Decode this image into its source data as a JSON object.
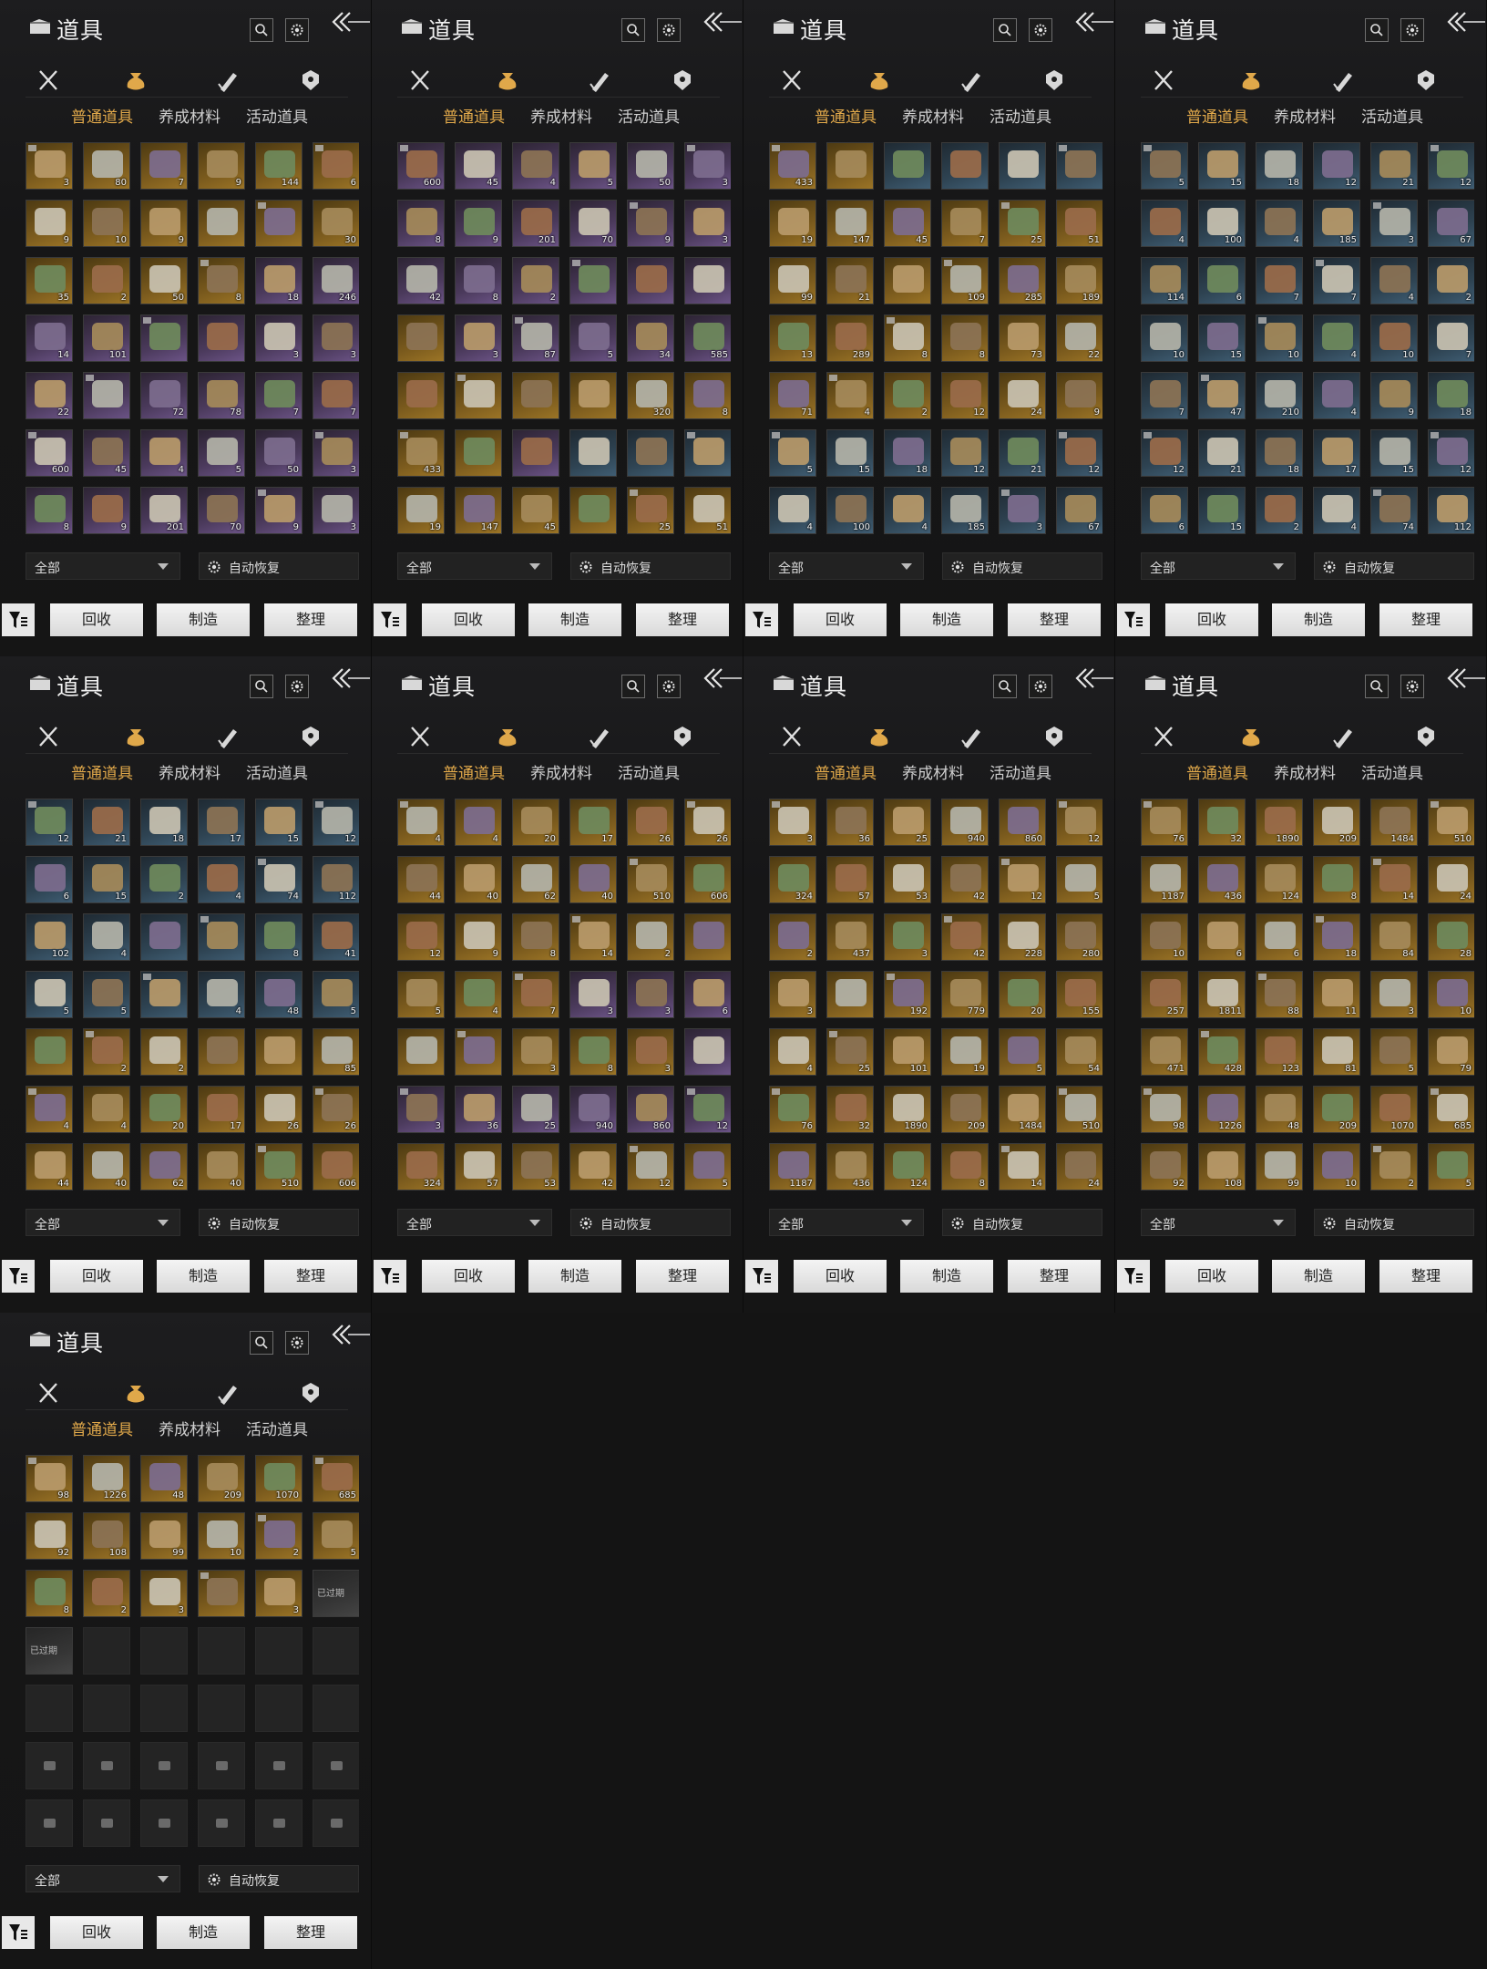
{
  "screen": {
    "title": "道具",
    "subtabs": [
      "普通道具",
      "养成材料",
      "活动道具"
    ],
    "active_subtab": 0,
    "filter": {
      "selected": "全部"
    },
    "auto_restore_label": "自动恢复",
    "buttons": {
      "recycle": "回收",
      "craft": "制造",
      "sort": "整理"
    },
    "category_icons": [
      "crossed-swords-icon",
      "pouch-icon",
      "scroll-brush-icon",
      "badge-icon"
    ],
    "colors": {
      "accent": "#e0a84a",
      "background": "#141414"
    }
  },
  "panels": [
    {
      "items": [
        [
          "3",
          "g"
        ],
        [
          "80",
          "g"
        ],
        [
          "7",
          "g"
        ],
        [
          "9",
          "g"
        ],
        [
          "144",
          "g"
        ],
        [
          "6",
          "g"
        ],
        [
          "9",
          "g"
        ],
        [
          "10",
          "g"
        ],
        [
          "9",
          "g"
        ],
        [
          "",
          "g"
        ],
        [
          "",
          "g"
        ],
        [
          "30",
          "g"
        ],
        [
          "35",
          "g"
        ],
        [
          "2",
          "g"
        ],
        [
          "50",
          "g"
        ],
        [
          "8",
          "g"
        ],
        [
          "18",
          "p"
        ],
        [
          "246",
          "p"
        ],
        [
          "14",
          "p"
        ],
        [
          "101",
          "p"
        ],
        [
          "",
          "p"
        ],
        [
          "",
          "p"
        ],
        [
          "3",
          "p"
        ],
        [
          "3",
          "p"
        ],
        [
          "22",
          "p"
        ],
        [
          "",
          "p"
        ],
        [
          "72",
          "p"
        ],
        [
          "78",
          "p"
        ],
        [
          "7",
          "p"
        ],
        [
          "7",
          "p"
        ],
        [
          "600",
          "p"
        ],
        [
          "45",
          "p"
        ],
        [
          "4",
          "p"
        ],
        [
          "5",
          "p"
        ],
        [
          "50",
          "p"
        ],
        [
          "3",
          "p"
        ],
        [
          "8",
          "p"
        ],
        [
          "9",
          "p"
        ],
        [
          "201",
          "p"
        ],
        [
          "70",
          "p"
        ],
        [
          "9",
          "p"
        ],
        [
          "3",
          "p"
        ]
      ]
    },
    {
      "items": [
        [
          "600",
          "p"
        ],
        [
          "45",
          "p"
        ],
        [
          "4",
          "p"
        ],
        [
          "5",
          "p"
        ],
        [
          "50",
          "p"
        ],
        [
          "3",
          "p"
        ],
        [
          "8",
          "p"
        ],
        [
          "9",
          "p"
        ],
        [
          "201",
          "p"
        ],
        [
          "70",
          "p"
        ],
        [
          "9",
          "p"
        ],
        [
          "3",
          "p"
        ],
        [
          "42",
          "p"
        ],
        [
          "8",
          "p"
        ],
        [
          "2",
          "p"
        ],
        [
          "",
          "p"
        ],
        [
          "",
          "p"
        ],
        [
          "",
          "p"
        ],
        [
          "",
          "g"
        ],
        [
          "3",
          "p"
        ],
        [
          "87",
          "p"
        ],
        [
          "5",
          "p"
        ],
        [
          "34",
          "p"
        ],
        [
          "585",
          "p"
        ],
        [
          "",
          "g"
        ],
        [
          "",
          "g"
        ],
        [
          "",
          "g"
        ],
        [
          "",
          "g"
        ],
        [
          "320",
          "g"
        ],
        [
          "8",
          "g"
        ],
        [
          "433",
          "g"
        ],
        [
          "",
          "g"
        ],
        [
          "",
          "p"
        ],
        [
          "",
          "b"
        ],
        [
          "",
          "b"
        ],
        [
          "",
          "b"
        ],
        [
          "19",
          "g"
        ],
        [
          "147",
          "g"
        ],
        [
          "45",
          "g"
        ],
        [
          "",
          "g"
        ],
        [
          "25",
          "g"
        ],
        [
          "51",
          "g"
        ]
      ]
    },
    {
      "items": [
        [
          "433",
          "g"
        ],
        [
          "",
          "g"
        ],
        [
          "",
          "b"
        ],
        [
          "",
          "b"
        ],
        [
          "",
          "b"
        ],
        [
          "",
          "b"
        ],
        [
          "19",
          "g"
        ],
        [
          "147",
          "g"
        ],
        [
          "45",
          "g"
        ],
        [
          "7",
          "g"
        ],
        [
          "25",
          "g"
        ],
        [
          "51",
          "g"
        ],
        [
          "99",
          "g"
        ],
        [
          "21",
          "g"
        ],
        [
          "",
          "g"
        ],
        [
          "109",
          "g"
        ],
        [
          "285",
          "g"
        ],
        [
          "189",
          "g"
        ],
        [
          "13",
          "g"
        ],
        [
          "289",
          "g"
        ],
        [
          "8",
          "g"
        ],
        [
          "8",
          "g"
        ],
        [
          "73",
          "g"
        ],
        [
          "22",
          "g"
        ],
        [
          "71",
          "g"
        ],
        [
          "4",
          "g"
        ],
        [
          "2",
          "g"
        ],
        [
          "12",
          "g"
        ],
        [
          "24",
          "g"
        ],
        [
          "9",
          "g"
        ],
        [
          "5",
          "b"
        ],
        [
          "15",
          "b"
        ],
        [
          "18",
          "b"
        ],
        [
          "12",
          "b"
        ],
        [
          "21",
          "b"
        ],
        [
          "12",
          "b"
        ],
        [
          "4",
          "b"
        ],
        [
          "100",
          "b"
        ],
        [
          "4",
          "b"
        ],
        [
          "185",
          "b"
        ],
        [
          "3",
          "b"
        ],
        [
          "67",
          "b"
        ]
      ]
    },
    {
      "items": [
        [
          "5",
          "b"
        ],
        [
          "15",
          "b"
        ],
        [
          "18",
          "b"
        ],
        [
          "12",
          "b"
        ],
        [
          "21",
          "b"
        ],
        [
          "12",
          "b"
        ],
        [
          "4",
          "b"
        ],
        [
          "100",
          "b"
        ],
        [
          "4",
          "b"
        ],
        [
          "185",
          "b"
        ],
        [
          "3",
          "b"
        ],
        [
          "67",
          "b"
        ],
        [
          "114",
          "b"
        ],
        [
          "6",
          "b"
        ],
        [
          "7",
          "b"
        ],
        [
          "7",
          "b"
        ],
        [
          "4",
          "b"
        ],
        [
          "2",
          "b"
        ],
        [
          "10",
          "b"
        ],
        [
          "15",
          "b"
        ],
        [
          "10",
          "b"
        ],
        [
          "4",
          "b"
        ],
        [
          "10",
          "b"
        ],
        [
          "7",
          "b"
        ],
        [
          "7",
          "b"
        ],
        [
          "47",
          "b"
        ],
        [
          "210",
          "b"
        ],
        [
          "4",
          "b"
        ],
        [
          "9",
          "b"
        ],
        [
          "18",
          "b"
        ],
        [
          "12",
          "b"
        ],
        [
          "21",
          "b"
        ],
        [
          "18",
          "b"
        ],
        [
          "17",
          "b"
        ],
        [
          "15",
          "b"
        ],
        [
          "12",
          "b"
        ],
        [
          "6",
          "b"
        ],
        [
          "15",
          "b"
        ],
        [
          "2",
          "b"
        ],
        [
          "4",
          "b"
        ],
        [
          "74",
          "b"
        ],
        [
          "112",
          "b"
        ]
      ]
    },
    {
      "items": [
        [
          "12",
          "b"
        ],
        [
          "21",
          "b"
        ],
        [
          "18",
          "b"
        ],
        [
          "17",
          "b"
        ],
        [
          "15",
          "b"
        ],
        [
          "12",
          "b"
        ],
        [
          "6",
          "b"
        ],
        [
          "15",
          "b"
        ],
        [
          "2",
          "b"
        ],
        [
          "4",
          "b"
        ],
        [
          "74",
          "b"
        ],
        [
          "112",
          "b"
        ],
        [
          "102",
          "b"
        ],
        [
          "4",
          "b"
        ],
        [
          "",
          "b"
        ],
        [
          "",
          "b"
        ],
        [
          "8",
          "b"
        ],
        [
          "41",
          "b"
        ],
        [
          "5",
          "b"
        ],
        [
          "5",
          "b"
        ],
        [
          "",
          "b"
        ],
        [
          "4",
          "b"
        ],
        [
          "48",
          "b"
        ],
        [
          "5",
          "b"
        ],
        [
          "",
          "g"
        ],
        [
          "2",
          "g"
        ],
        [
          "2",
          "g"
        ],
        [
          "",
          "g"
        ],
        [
          "",
          "g"
        ],
        [
          "85",
          "g"
        ],
        [
          "4",
          "g"
        ],
        [
          "4",
          "g"
        ],
        [
          "20",
          "g"
        ],
        [
          "17",
          "g"
        ],
        [
          "26",
          "g"
        ],
        [
          "26",
          "g"
        ],
        [
          "44",
          "g"
        ],
        [
          "40",
          "g"
        ],
        [
          "62",
          "g"
        ],
        [
          "40",
          "g"
        ],
        [
          "510",
          "g"
        ],
        [
          "606",
          "g"
        ]
      ]
    },
    {
      "items": [
        [
          "4",
          "g"
        ],
        [
          "4",
          "g"
        ],
        [
          "20",
          "g"
        ],
        [
          "17",
          "g"
        ],
        [
          "26",
          "g"
        ],
        [
          "26",
          "g"
        ],
        [
          "44",
          "g"
        ],
        [
          "40",
          "g"
        ],
        [
          "62",
          "g"
        ],
        [
          "40",
          "g"
        ],
        [
          "510",
          "g"
        ],
        [
          "606",
          "g"
        ],
        [
          "12",
          "g"
        ],
        [
          "9",
          "g"
        ],
        [
          "8",
          "g"
        ],
        [
          "14",
          "g"
        ],
        [
          "2",
          "g"
        ],
        [
          "",
          "g"
        ],
        [
          "5",
          "g"
        ],
        [
          "4",
          "g"
        ],
        [
          "7",
          "g"
        ],
        [
          "3",
          "p"
        ],
        [
          "3",
          "p"
        ],
        [
          "6",
          "p"
        ],
        [
          "",
          "g"
        ],
        [
          "",
          "g"
        ],
        [
          "3",
          "g"
        ],
        [
          "8",
          "g"
        ],
        [
          "3",
          "g"
        ],
        [
          "",
          "p"
        ],
        [
          "3",
          "p"
        ],
        [
          "36",
          "p"
        ],
        [
          "25",
          "p"
        ],
        [
          "940",
          "p"
        ],
        [
          "860",
          "p"
        ],
        [
          "12",
          "p"
        ],
        [
          "324",
          "g"
        ],
        [
          "57",
          "g"
        ],
        [
          "53",
          "g"
        ],
        [
          "42",
          "g"
        ],
        [
          "12",
          "g"
        ],
        [
          "5",
          "g"
        ]
      ]
    },
    {
      "items": [
        [
          "3",
          "g"
        ],
        [
          "36",
          "g"
        ],
        [
          "25",
          "g"
        ],
        [
          "940",
          "g"
        ],
        [
          "860",
          "g"
        ],
        [
          "12",
          "g"
        ],
        [
          "324",
          "g"
        ],
        [
          "57",
          "g"
        ],
        [
          "53",
          "g"
        ],
        [
          "42",
          "g"
        ],
        [
          "12",
          "g"
        ],
        [
          "5",
          "g"
        ],
        [
          "2",
          "g"
        ],
        [
          "437",
          "g"
        ],
        [
          "3",
          "g"
        ],
        [
          "42",
          "g"
        ],
        [
          "228",
          "g"
        ],
        [
          "280",
          "g"
        ],
        [
          "3",
          "g"
        ],
        [
          "",
          "g"
        ],
        [
          "192",
          "g"
        ],
        [
          "779",
          "g"
        ],
        [
          "20",
          "g"
        ],
        [
          "155",
          "g"
        ],
        [
          "4",
          "g"
        ],
        [
          "25",
          "g"
        ],
        [
          "101",
          "g"
        ],
        [
          "19",
          "g"
        ],
        [
          "5",
          "g"
        ],
        [
          "54",
          "g"
        ],
        [
          "76",
          "g"
        ],
        [
          "32",
          "g"
        ],
        [
          "1890",
          "g"
        ],
        [
          "209",
          "g"
        ],
        [
          "1484",
          "g"
        ],
        [
          "510",
          "g"
        ],
        [
          "1187",
          "g"
        ],
        [
          "436",
          "g"
        ],
        [
          "124",
          "g"
        ],
        [
          "8",
          "g"
        ],
        [
          "14",
          "g"
        ],
        [
          "24",
          "g"
        ]
      ]
    },
    {
      "items": [
        [
          "76",
          "g"
        ],
        [
          "32",
          "g"
        ],
        [
          "1890",
          "g"
        ],
        [
          "209",
          "g"
        ],
        [
          "1484",
          "g"
        ],
        [
          "510",
          "g"
        ],
        [
          "1187",
          "g"
        ],
        [
          "436",
          "g"
        ],
        [
          "124",
          "g"
        ],
        [
          "8",
          "g"
        ],
        [
          "14",
          "g"
        ],
        [
          "24",
          "g"
        ],
        [
          "10",
          "g"
        ],
        [
          "6",
          "g"
        ],
        [
          "6",
          "g"
        ],
        [
          "18",
          "g"
        ],
        [
          "84",
          "g"
        ],
        [
          "28",
          "g"
        ],
        [
          "257",
          "g"
        ],
        [
          "1811",
          "g"
        ],
        [
          "88",
          "g"
        ],
        [
          "11",
          "g"
        ],
        [
          "3",
          "g"
        ],
        [
          "10",
          "g"
        ],
        [
          "471",
          "g"
        ],
        [
          "428",
          "g"
        ],
        [
          "123",
          "g"
        ],
        [
          "81",
          "g"
        ],
        [
          "5",
          "g"
        ],
        [
          "79",
          "g"
        ],
        [
          "98",
          "g"
        ],
        [
          "1226",
          "g"
        ],
        [
          "48",
          "g"
        ],
        [
          "209",
          "g"
        ],
        [
          "1070",
          "g"
        ],
        [
          "685",
          "g"
        ],
        [
          "92",
          "g"
        ],
        [
          "108",
          "g"
        ],
        [
          "99",
          "g"
        ],
        [
          "10",
          "g"
        ],
        [
          "2",
          "g"
        ],
        [
          "5",
          "g"
        ]
      ]
    },
    {
      "items": [
        [
          "98",
          "g"
        ],
        [
          "1226",
          "g"
        ],
        [
          "48",
          "g"
        ],
        [
          "209",
          "g"
        ],
        [
          "1070",
          "g"
        ],
        [
          "685",
          "g"
        ],
        [
          "92",
          "g"
        ],
        [
          "108",
          "g"
        ],
        [
          "99",
          "g"
        ],
        [
          "10",
          "g"
        ],
        [
          "2",
          "g"
        ],
        [
          "5",
          "g"
        ],
        [
          "8",
          "g"
        ],
        [
          "2",
          "g"
        ],
        [
          "3",
          "g"
        ],
        [
          "",
          "g"
        ],
        [
          "3",
          "g"
        ],
        [
          "已过期",
          "x"
        ],
        [
          "已过期",
          "x"
        ],
        [
          "",
          "e"
        ],
        [
          "",
          "e"
        ],
        [
          "",
          "e"
        ],
        [
          "",
          "e"
        ],
        [
          "",
          "e"
        ],
        [
          "",
          "e"
        ],
        [
          "",
          "e"
        ],
        [
          "",
          "e"
        ],
        [
          "",
          "e"
        ],
        [
          "",
          "e"
        ],
        [
          "",
          "e"
        ],
        [
          "",
          "l"
        ],
        [
          "",
          "l"
        ],
        [
          "",
          "l"
        ],
        [
          "",
          "l"
        ],
        [
          "",
          "l"
        ],
        [
          "",
          "l"
        ],
        [
          "",
          "l"
        ],
        [
          "",
          "l"
        ],
        [
          "",
          "l"
        ],
        [
          "",
          "l"
        ],
        [
          "",
          "l"
        ],
        [
          "",
          "l"
        ]
      ]
    }
  ]
}
